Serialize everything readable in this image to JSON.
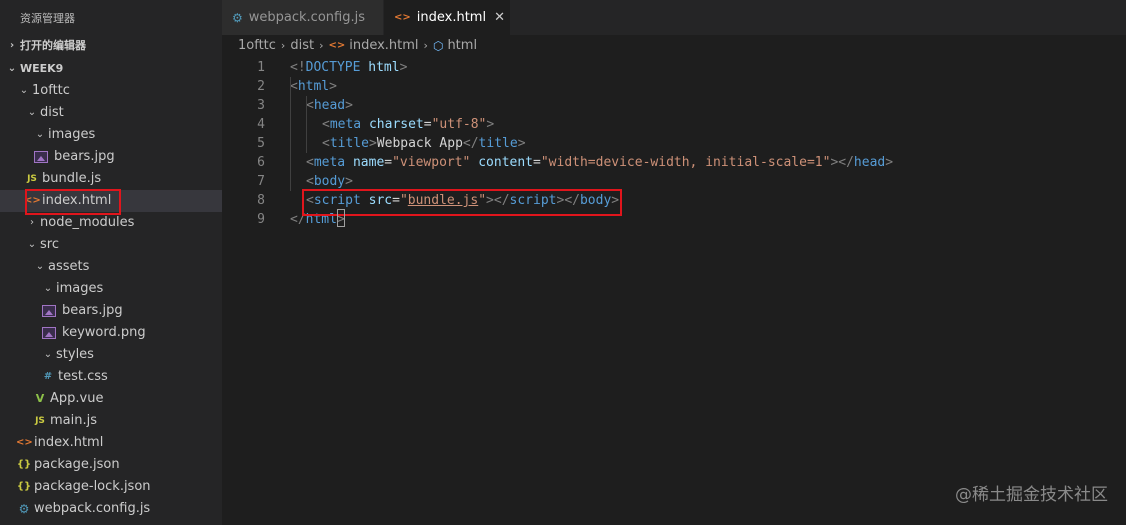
{
  "sidebar": {
    "title": "资源管理器",
    "open_editors": "打开的编辑器",
    "workspace": "WEEK9",
    "tree": [
      {
        "label": "1ofttc",
        "indent": 1,
        "kind": "folder-open"
      },
      {
        "label": "dist",
        "indent": 2,
        "kind": "folder-open"
      },
      {
        "label": "images",
        "indent": 3,
        "kind": "folder-open"
      },
      {
        "label": "bears.jpg",
        "indent": 3,
        "kind": "image"
      },
      {
        "label": "bundle.js",
        "indent": 2,
        "kind": "js"
      },
      {
        "label": "index.html",
        "indent": 2,
        "kind": "html",
        "selected": true
      },
      {
        "label": "node_modules",
        "indent": 2,
        "kind": "folder-closed"
      },
      {
        "label": "src",
        "indent": 2,
        "kind": "folder-open"
      },
      {
        "label": "assets",
        "indent": 3,
        "kind": "folder-open"
      },
      {
        "label": "images",
        "indent": 4,
        "kind": "folder-open"
      },
      {
        "label": "bears.jpg",
        "indent": 4,
        "kind": "image"
      },
      {
        "label": "keyword.png",
        "indent": 4,
        "kind": "image"
      },
      {
        "label": "styles",
        "indent": 4,
        "kind": "folder-open"
      },
      {
        "label": "test.css",
        "indent": 4,
        "kind": "css"
      },
      {
        "label": "App.vue",
        "indent": 3,
        "kind": "vue"
      },
      {
        "label": "main.js",
        "indent": 3,
        "kind": "js"
      },
      {
        "label": "index.html",
        "indent": 1,
        "kind": "html"
      },
      {
        "label": "package.json",
        "indent": 1,
        "kind": "json"
      },
      {
        "label": "package-lock.json",
        "indent": 1,
        "kind": "json"
      },
      {
        "label": "webpack.config.js",
        "indent": 1,
        "kind": "gear"
      }
    ]
  },
  "tabs": [
    {
      "label": "webpack.config.js",
      "active": false
    },
    {
      "label": "index.html",
      "active": true
    }
  ],
  "breadcrumb": [
    "1ofttc",
    "dist",
    "index.html",
    "html"
  ],
  "code_lines": [
    {
      "n": "1",
      "indent": 0,
      "parts": [
        [
          "p",
          "<!"
        ],
        [
          "t",
          "DOCTYPE"
        ],
        [
          "a",
          " html"
        ],
        [
          "p",
          ">"
        ]
      ]
    },
    {
      "n": "2",
      "indent": 0,
      "parts": [
        [
          "p",
          "<"
        ],
        [
          "t",
          "html"
        ],
        [
          "p",
          ">"
        ]
      ]
    },
    {
      "n": "3",
      "indent": 1,
      "parts": [
        [
          "p",
          "<"
        ],
        [
          "t",
          "head"
        ],
        [
          "p",
          ">"
        ]
      ]
    },
    {
      "n": "4",
      "indent": 2,
      "parts": [
        [
          "p",
          "<"
        ],
        [
          "t",
          "meta"
        ],
        [
          "a",
          " charset"
        ],
        [
          "x",
          "="
        ],
        [
          "s",
          "\"utf-8\""
        ],
        [
          "p",
          ">"
        ]
      ]
    },
    {
      "n": "5",
      "indent": 2,
      "parts": [
        [
          "p",
          "<"
        ],
        [
          "t",
          "title"
        ],
        [
          "p",
          ">"
        ],
        [
          "x",
          "Webpack App"
        ],
        [
          "p",
          "</"
        ],
        [
          "t",
          "title"
        ],
        [
          "p",
          ">"
        ]
      ]
    },
    {
      "n": "6",
      "indent": 1,
      "parts": [
        [
          "p",
          "<"
        ],
        [
          "t",
          "meta"
        ],
        [
          "a",
          " name"
        ],
        [
          "x",
          "="
        ],
        [
          "s",
          "\"viewport\""
        ],
        [
          "a",
          " content"
        ],
        [
          "x",
          "="
        ],
        [
          "s",
          "\"width=device-width, initial-scale=1\""
        ],
        [
          "p",
          "></"
        ],
        [
          "t",
          "head"
        ],
        [
          "p",
          ">"
        ]
      ]
    },
    {
      "n": "7",
      "indent": 1,
      "parts": [
        [
          "p",
          "<"
        ],
        [
          "t",
          "body"
        ],
        [
          "p",
          ">"
        ]
      ]
    },
    {
      "n": "8",
      "indent": 1,
      "parts": [
        [
          "p",
          "<"
        ],
        [
          "t",
          "script"
        ],
        [
          "a",
          " src"
        ],
        [
          "x",
          "="
        ],
        [
          "s",
          "\""
        ],
        [
          "u",
          "bundle.js"
        ],
        [
          "s",
          "\""
        ],
        [
          "p",
          "></"
        ],
        [
          "t",
          "script"
        ],
        [
          "p",
          "></"
        ],
        [
          "t",
          "body"
        ],
        [
          "p",
          ">"
        ]
      ]
    },
    {
      "n": "9",
      "indent": 0,
      "parts": [
        [
          "p",
          "</"
        ],
        [
          "t",
          "html"
        ],
        [
          "p",
          ">"
        ]
      ]
    }
  ],
  "watermark": "@稀土掘金技术社区",
  "icons": {
    "chevron_down": "⌄",
    "chevron_right": "›",
    "html": "<>",
    "js": "JS",
    "css": "#",
    "json": "{}",
    "vue": "V",
    "gear": "⚙",
    "cube": "⬡",
    "close": "✕"
  },
  "colors": {
    "highlight_box": "#e0151c",
    "tag": "#569cd6",
    "attribute": "#9cdcfe",
    "string": "#ce9178",
    "punctuation": "#808080"
  }
}
